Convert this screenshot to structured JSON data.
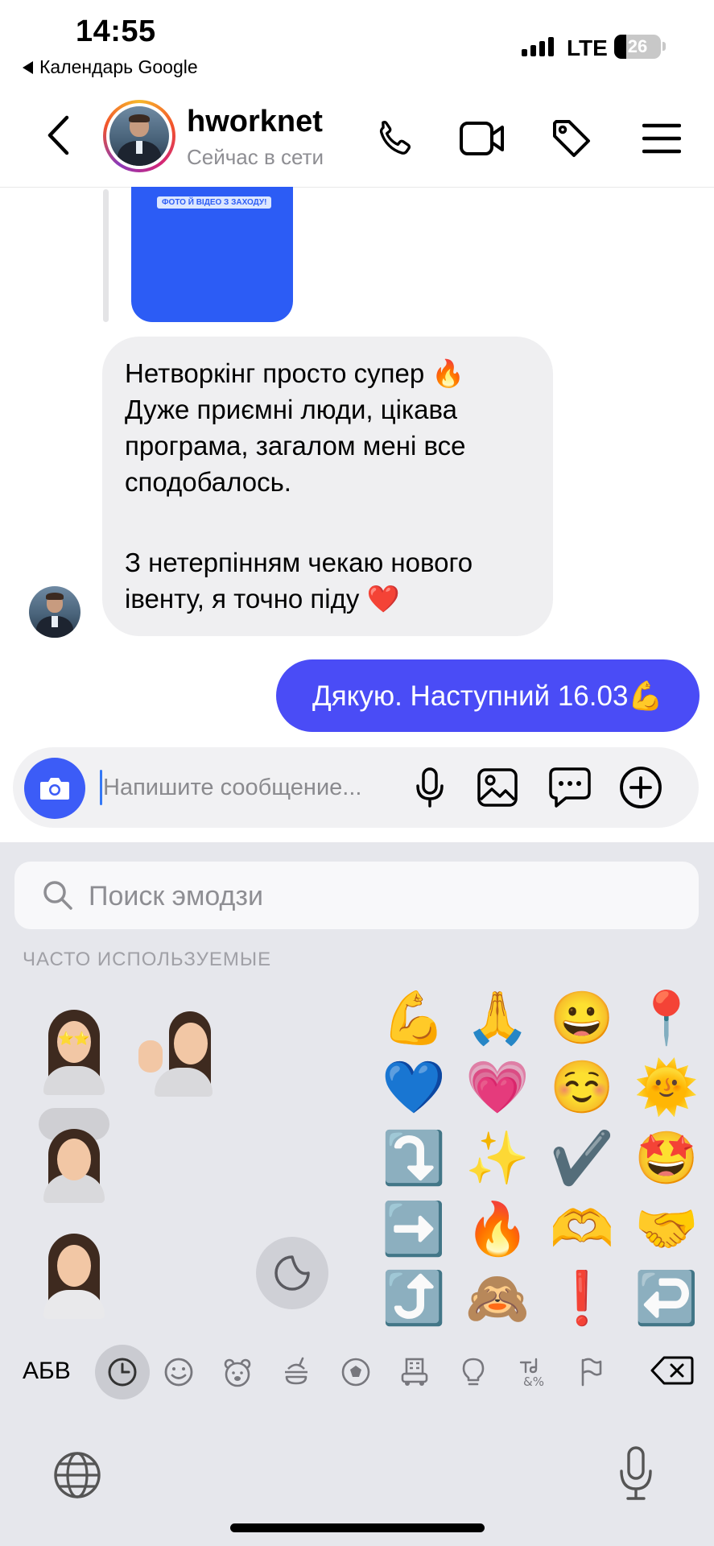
{
  "status_bar": {
    "time": "14:55",
    "back_app": "Календарь Google",
    "network": "LTE",
    "battery": "26",
    "battery_level": 0.26
  },
  "header": {
    "username": "hworknet",
    "status": "Сейчас в сети"
  },
  "chat": {
    "story_tag": "ФОТО Й ВІДЕО З ЗАХОДУ!",
    "incoming": {
      "lines": [
        "Нетворкінг просто супер 🔥",
        "Дуже приємні люди, цікава",
        "програма, загалом мені все",
        "сподобалось.",
        "З нетерпінням чекаю нового",
        "івенту, я точно піду ❤️"
      ]
    },
    "outgoing": {
      "text": "Дякую. Наступний 16.03💪"
    }
  },
  "composer": {
    "placeholder": "Напишите сообщение..."
  },
  "keyboard": {
    "search_placeholder": "Поиск эмодзи",
    "section_label": "ЧАСТО ИСПОЛЬЗУЕМЫЕ",
    "abc_label": "АБВ",
    "emojis": [
      [
        "💪",
        "🙏",
        "😀",
        "📍"
      ],
      [
        "💙",
        "💗",
        "☺️",
        "🌞"
      ],
      [
        "⤵️",
        "✨",
        "✔️",
        "🤩"
      ],
      [
        "➡️",
        "🔥",
        "🫶",
        "🤝"
      ],
      [
        "⤴️",
        "🙈",
        "❗",
        "↩️"
      ]
    ],
    "categories": [
      "recent-icon",
      "smiley-icon",
      "animal-icon",
      "food-icon",
      "sport-icon",
      "travel-icon",
      "objects-icon",
      "symbols-icon",
      "flag-icon"
    ]
  }
}
